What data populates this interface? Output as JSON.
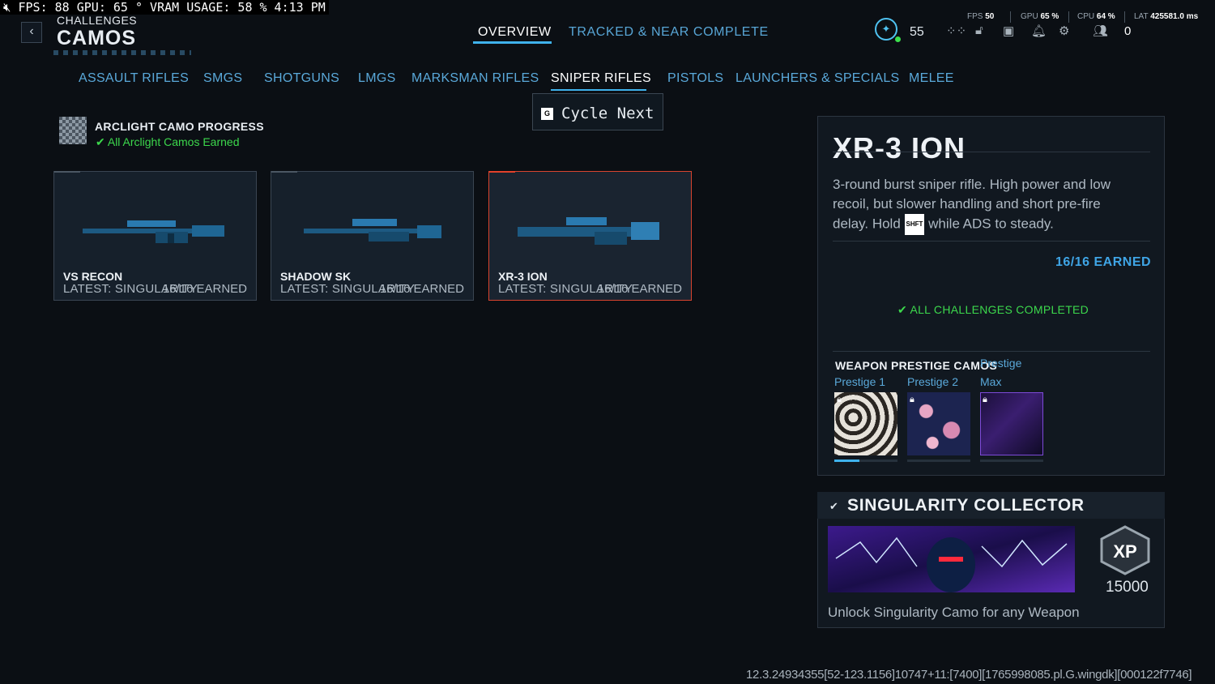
{
  "overlay": {
    "text": "FPS:   88 GPU: 65 ° VRAM USAGE: 58 % 4:13 PM",
    "mute_icon": "speaker-muted-icon"
  },
  "header": {
    "back_icon": "chevron-left-icon",
    "small_title": "CHALLENGES",
    "big_title": "CAMOS",
    "tabs": [
      {
        "label": "OVERVIEW",
        "active": true
      },
      {
        "label": "TRACKED & NEAR COMPLETE",
        "active": false
      }
    ],
    "level": "55",
    "currency": "0",
    "perf": [
      {
        "label": "FPS",
        "value": "50"
      },
      {
        "label": "GPU",
        "value": "65 %"
      },
      {
        "label": "CPU",
        "value": "64 %"
      },
      {
        "label": "LAT",
        "value": "425581.0 ms"
      }
    ],
    "icons": [
      "grid-icon",
      "lock-icon",
      "camera-icon",
      "bell-icon",
      "gear-icon",
      "friends-icon"
    ]
  },
  "categories": [
    {
      "label": "ASSAULT RIFLES",
      "active": false
    },
    {
      "label": "SMGS",
      "active": false
    },
    {
      "label": "SHOTGUNS",
      "active": false
    },
    {
      "label": "LMGS",
      "active": false
    },
    {
      "label": "MARKSMAN RIFLES",
      "active": false
    },
    {
      "label": "SNIPER RIFLES",
      "active": true
    },
    {
      "label": "PISTOLS",
      "active": false
    },
    {
      "label": "LAUNCHERS & SPECIALS",
      "active": false
    },
    {
      "label": "MELEE",
      "active": false
    }
  ],
  "cycle": {
    "key": "G",
    "label": "Cycle Next"
  },
  "arclight": {
    "title": "ARCLIGHT CAMO PROGRESS",
    "status": "All Arclight Camos Earned"
  },
  "weapons": [
    {
      "name": "VS RECON",
      "latest": "LATEST: SINGULARITY",
      "earned": "16/16 EARNED",
      "selected": false
    },
    {
      "name": "SHADOW SK",
      "latest": "LATEST: SINGULARITY",
      "earned": "16/16 EARNED",
      "selected": false
    },
    {
      "name": "XR-3 ION",
      "latest": "LATEST: SINGULARITY",
      "earned": "16/16 EARNED",
      "selected": true
    }
  ],
  "detail": {
    "name": "XR-3 ION",
    "desc_pre": "3-round burst sniper rifle. High power and low recoil, but slower handling and short pre-fire delay. Hold",
    "shift_key": "SHFT",
    "desc_post": "while ADS to steady.",
    "earned": "16/16 EARNED",
    "all_challenges": "ALL CHALLENGES COMPLETED",
    "prestige_title": "WEAPON PRESTIGE CAMOS",
    "prestige_overlap": "Prestige",
    "prestige": [
      {
        "label": "Prestige 1",
        "progress": 0.4
      },
      {
        "label": "Prestige 2",
        "progress": 0
      },
      {
        "label": "Max",
        "progress": 0
      }
    ]
  },
  "collector": {
    "title": "SINGULARITY COLLECTOR",
    "xp_label": "XP",
    "xp": "15000",
    "unlock": "Unlock Singularity Camo for any Weapon"
  },
  "build": "12.3.24934355[52-123.1156]10747+11:[7400][1765998085.pl.G.wingdk][000122f7746]"
}
